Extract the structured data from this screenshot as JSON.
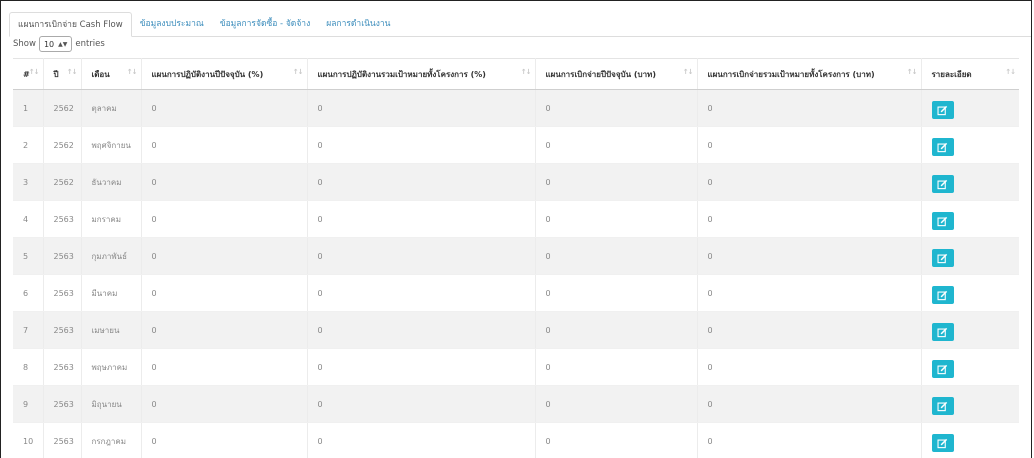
{
  "tabs": [
    {
      "label": "แผนการเบิกจ่าย Cash Flow",
      "active": true
    },
    {
      "label": "ข้อมูลงบประมาณ",
      "active": false
    },
    {
      "label": "ข้อมูลการจัดซื้อ - จัดจ้าง",
      "active": false
    },
    {
      "label": "ผลการดำเนินงาน",
      "active": false
    }
  ],
  "length_menu": {
    "show": "Show",
    "value": "10",
    "entries": "entries"
  },
  "table": {
    "columns": [
      "#",
      "ปี",
      "เดือน",
      "แผนการปฏิบัติงานปีปัจจุบัน (%)",
      "แผนการปฏิบัติงานรวมเป้าหมายทั้งโครงการ (%)",
      "แผนการเบิกจ่ายปีปัจจุบัน (บาท)",
      "แผนการเบิกจ่ายรวมเป้าหมายทั้งโครงการ (บาท)",
      "รายละเอียด"
    ],
    "rows": [
      {
        "no": "1",
        "year": "2562",
        "month": "ตุลาคม",
        "p1": "0",
        "p2": "0",
        "p3": "0",
        "p4": "0"
      },
      {
        "no": "2",
        "year": "2562",
        "month": "พฤศจิกายน",
        "p1": "0",
        "p2": "0",
        "p3": "0",
        "p4": "0"
      },
      {
        "no": "3",
        "year": "2562",
        "month": "ธันวาคม",
        "p1": "0",
        "p2": "0",
        "p3": "0",
        "p4": "0"
      },
      {
        "no": "4",
        "year": "2563",
        "month": "มกราคม",
        "p1": "0",
        "p2": "0",
        "p3": "0",
        "p4": "0"
      },
      {
        "no": "5",
        "year": "2563",
        "month": "กุมภาพันธ์",
        "p1": "0",
        "p2": "0",
        "p3": "0",
        "p4": "0"
      },
      {
        "no": "6",
        "year": "2563",
        "month": "มีนาคม",
        "p1": "0",
        "p2": "0",
        "p3": "0",
        "p4": "0"
      },
      {
        "no": "7",
        "year": "2563",
        "month": "เมษายน",
        "p1": "0",
        "p2": "0",
        "p3": "0",
        "p4": "0"
      },
      {
        "no": "8",
        "year": "2563",
        "month": "พฤษภาคม",
        "p1": "0",
        "p2": "0",
        "p3": "0",
        "p4": "0"
      },
      {
        "no": "9",
        "year": "2563",
        "month": "มิถุนายน",
        "p1": "0",
        "p2": "0",
        "p3": "0",
        "p4": "0"
      },
      {
        "no": "10",
        "year": "2563",
        "month": "กรกฎาคม",
        "p1": "0",
        "p2": "0",
        "p3": "0",
        "p4": "0"
      }
    ],
    "action_icon": "edit-icon"
  },
  "colors": {
    "link": "#3c8dbc",
    "button": "#1fb6cf",
    "stripe": "#f2f2f2"
  }
}
